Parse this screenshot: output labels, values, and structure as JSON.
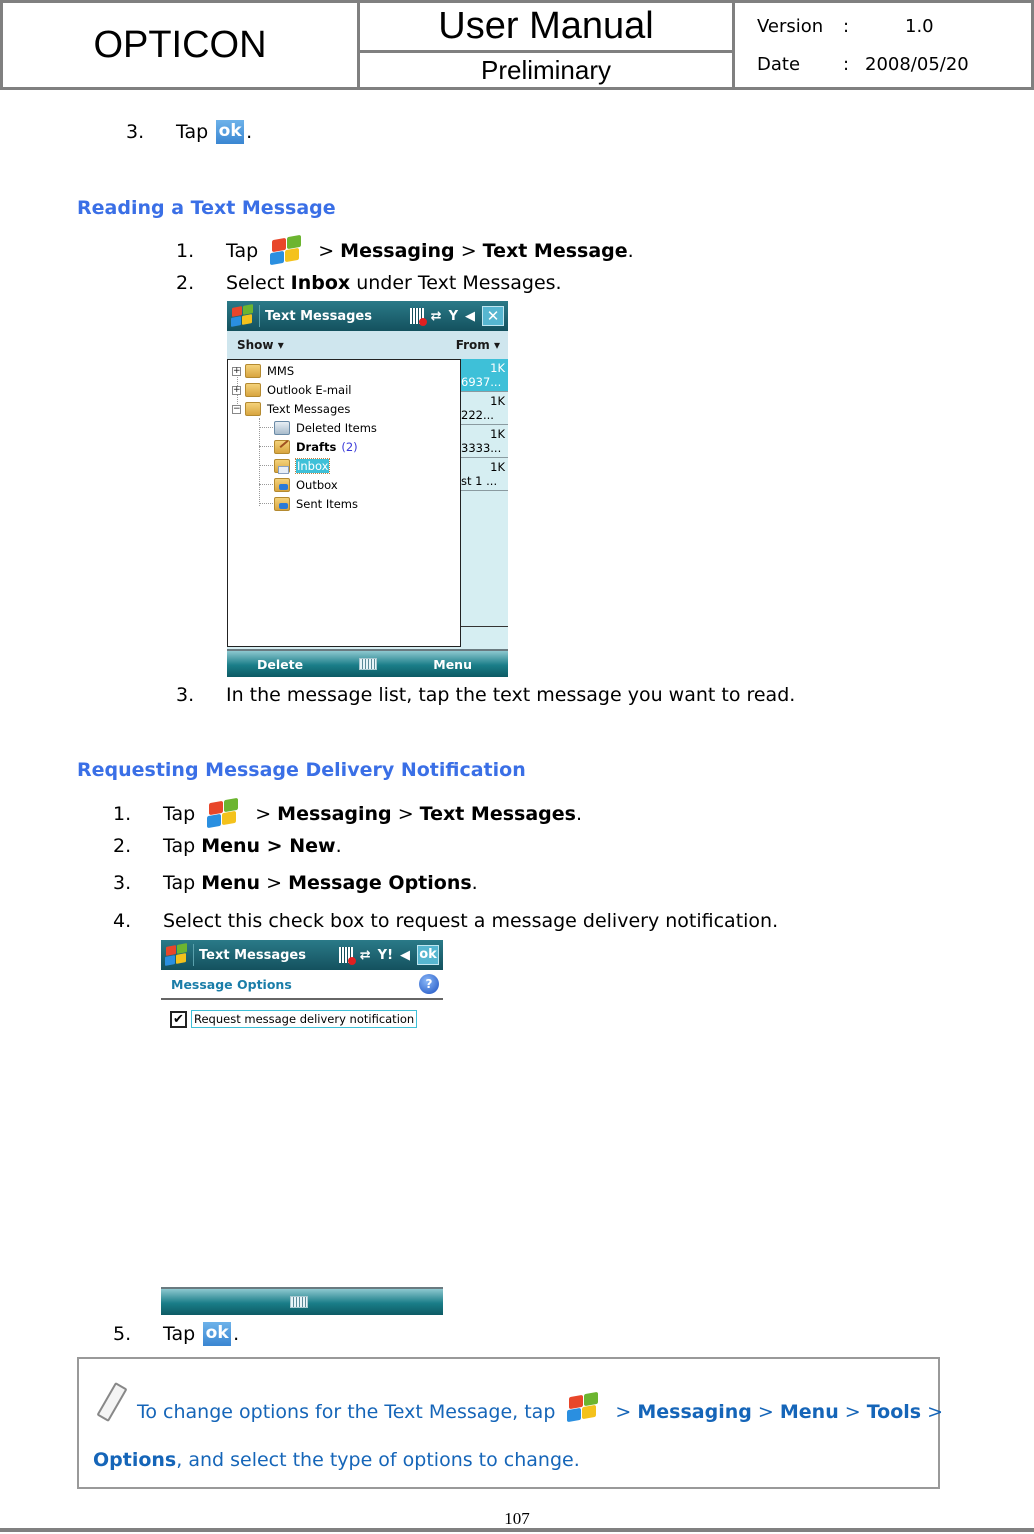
{
  "header": {
    "company": "OPTICON",
    "doc_title": "User Manual",
    "status": "Preliminary",
    "version_label": "Version",
    "version_sep": ":",
    "version_value": "1.0",
    "date_label": "Date",
    "date_sep": ":",
    "date_value": "2008/05/20"
  },
  "prev_step": {
    "num": "3.",
    "text": "Tap",
    "icon": "ok-icon",
    "icon_text": "ok",
    "suffix": "."
  },
  "section1": {
    "heading": "Reading a Text Message",
    "steps": [
      {
        "num": "1.",
        "pre": "Tap",
        "parts": [
          " > ",
          "Messaging",
          " > ",
          "Text Message",
          "."
        ]
      },
      {
        "num": "2.",
        "pre": "Select ",
        "bold": "Inbox",
        "post": " under Text Messages."
      },
      {
        "num": "3.",
        "text": "In the message list, tap the text message you want to read."
      }
    ],
    "screenshot": {
      "title": "Text Messages",
      "close_label": "✕",
      "menu_left": "Show ▾",
      "menu_right": "From ▾",
      "folders": [
        {
          "label": "MMS",
          "expander": "+"
        },
        {
          "label": "Outlook E-mail",
          "expander": "+"
        },
        {
          "label": "Text Messages",
          "expander": "−"
        },
        {
          "label": "Deleted Items"
        },
        {
          "label": "Drafts",
          "count": "(2)"
        },
        {
          "label": "Inbox",
          "selected": true
        },
        {
          "label": "Outbox"
        },
        {
          "label": "Sent Items"
        }
      ],
      "messages": [
        {
          "size": "1K",
          "from": "6937..."
        },
        {
          "size": "1K",
          "from": "222..."
        },
        {
          "size": "1K",
          "from": "3333..."
        },
        {
          "size": "1K",
          "from": "st 1 ..."
        }
      ],
      "softkey_left": "Delete",
      "softkey_right": "Menu"
    }
  },
  "section2": {
    "heading": "Requesting Message Delivery Notification",
    "steps": [
      {
        "num": "1.",
        "pre": "Tap",
        "parts": [
          " > ",
          "Messaging",
          " > ",
          "Text Messages",
          "."
        ]
      },
      {
        "num": "2.",
        "pre": "Tap ",
        "bold": "Menu > New",
        "post": "."
      },
      {
        "num": "3.",
        "pre": "Tap ",
        "bold": "Menu",
        "mid": " > ",
        "bold2": "Message Options",
        "post": "."
      },
      {
        "num": "4.",
        "text": "Select this check box to request a message delivery notification."
      },
      {
        "num": "5.",
        "text": "Tap",
        "icon_text": "ok",
        "suffix": "."
      }
    ],
    "screenshot": {
      "title": "Text Messages",
      "ok_label": "ok",
      "options_heading": "Message Options",
      "help_label": "?",
      "checkbox_label": "Request message delivery notification",
      "checkbox_checked": true
    }
  },
  "note": {
    "line1_pre": "To change options for the Text Message, tap",
    "line1_parts": [
      " > ",
      "Messaging",
      " > ",
      "Menu",
      " > ",
      "Tools",
      " >"
    ],
    "line2_bold": "Options",
    "line2_post": ", and select the type of options to change."
  },
  "footer": {
    "page_number": "107"
  }
}
